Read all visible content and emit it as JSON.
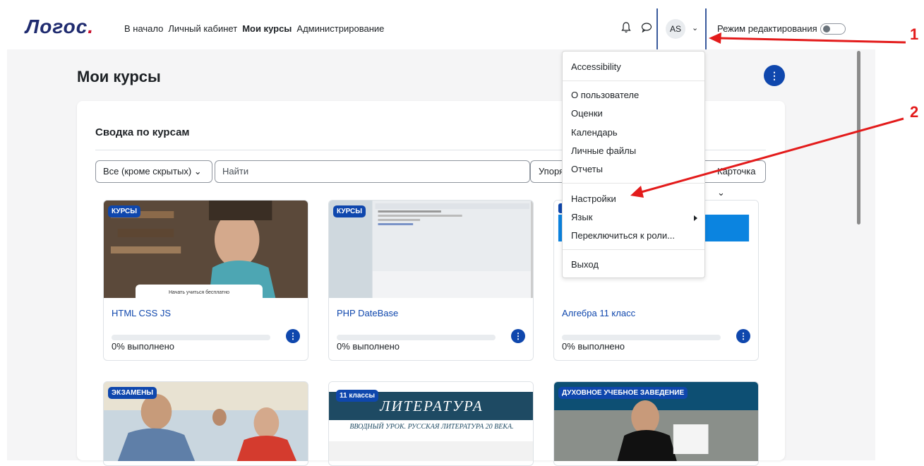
{
  "header": {
    "logo_main": "Логос",
    "logo_accent": ".",
    "nav": [
      "В начало",
      "Личный кабинет",
      "Мои курсы",
      "Администрирование"
    ],
    "nav_active_index": 2,
    "avatar_initials": "AS",
    "edit_mode_label": "Режим редактирования"
  },
  "page": {
    "title": "Мои курсы"
  },
  "overview": {
    "title": "Сводка по курсам",
    "filter_label": "Все (кроме скрытых)",
    "search_placeholder": "Найти",
    "sort_label": "Упоря",
    "view_label": "Карточка"
  },
  "courses": [
    {
      "badge": "КУРСЫ",
      "name": "HTML CSS JS",
      "progress_text": "0% выполнено",
      "progress": 0,
      "image_caption": "Начать учиться бесплатно"
    },
    {
      "badge": "КУРСЫ",
      "name": "PHP DateBase",
      "progress_text": "0% выполнено",
      "progress": 0
    },
    {
      "badge": "",
      "name": "Алгебра 11 класс",
      "progress_text": "0% выполнено",
      "progress": 0
    },
    {
      "badge": "ЭКЗАМЕНЫ"
    },
    {
      "badge": "11 классы",
      "image_title": "ЛИТЕРАТУРА",
      "image_subtitle": "ВВОДНЫЙ УРОК. РУССКАЯ ЛИТЕРАТУРА 20 ВЕКА."
    },
    {
      "badge": "ДУХОВНОЕ УЧЕБНОЕ ЗАВЕДЕНИЕ"
    }
  ],
  "user_menu": {
    "items": [
      "Accessibility",
      "О пользователе",
      "Оценки",
      "Календарь",
      "Личные файлы",
      "Отчеты",
      "Настройки",
      "Язык",
      "Переключиться к роли...",
      "Выход"
    ]
  },
  "annotations": {
    "marker1": "1",
    "marker2": "2"
  },
  "colors": {
    "brand": "#1f2b6f",
    "accent": "#0f47ad",
    "arrow": "#e31b1b"
  }
}
